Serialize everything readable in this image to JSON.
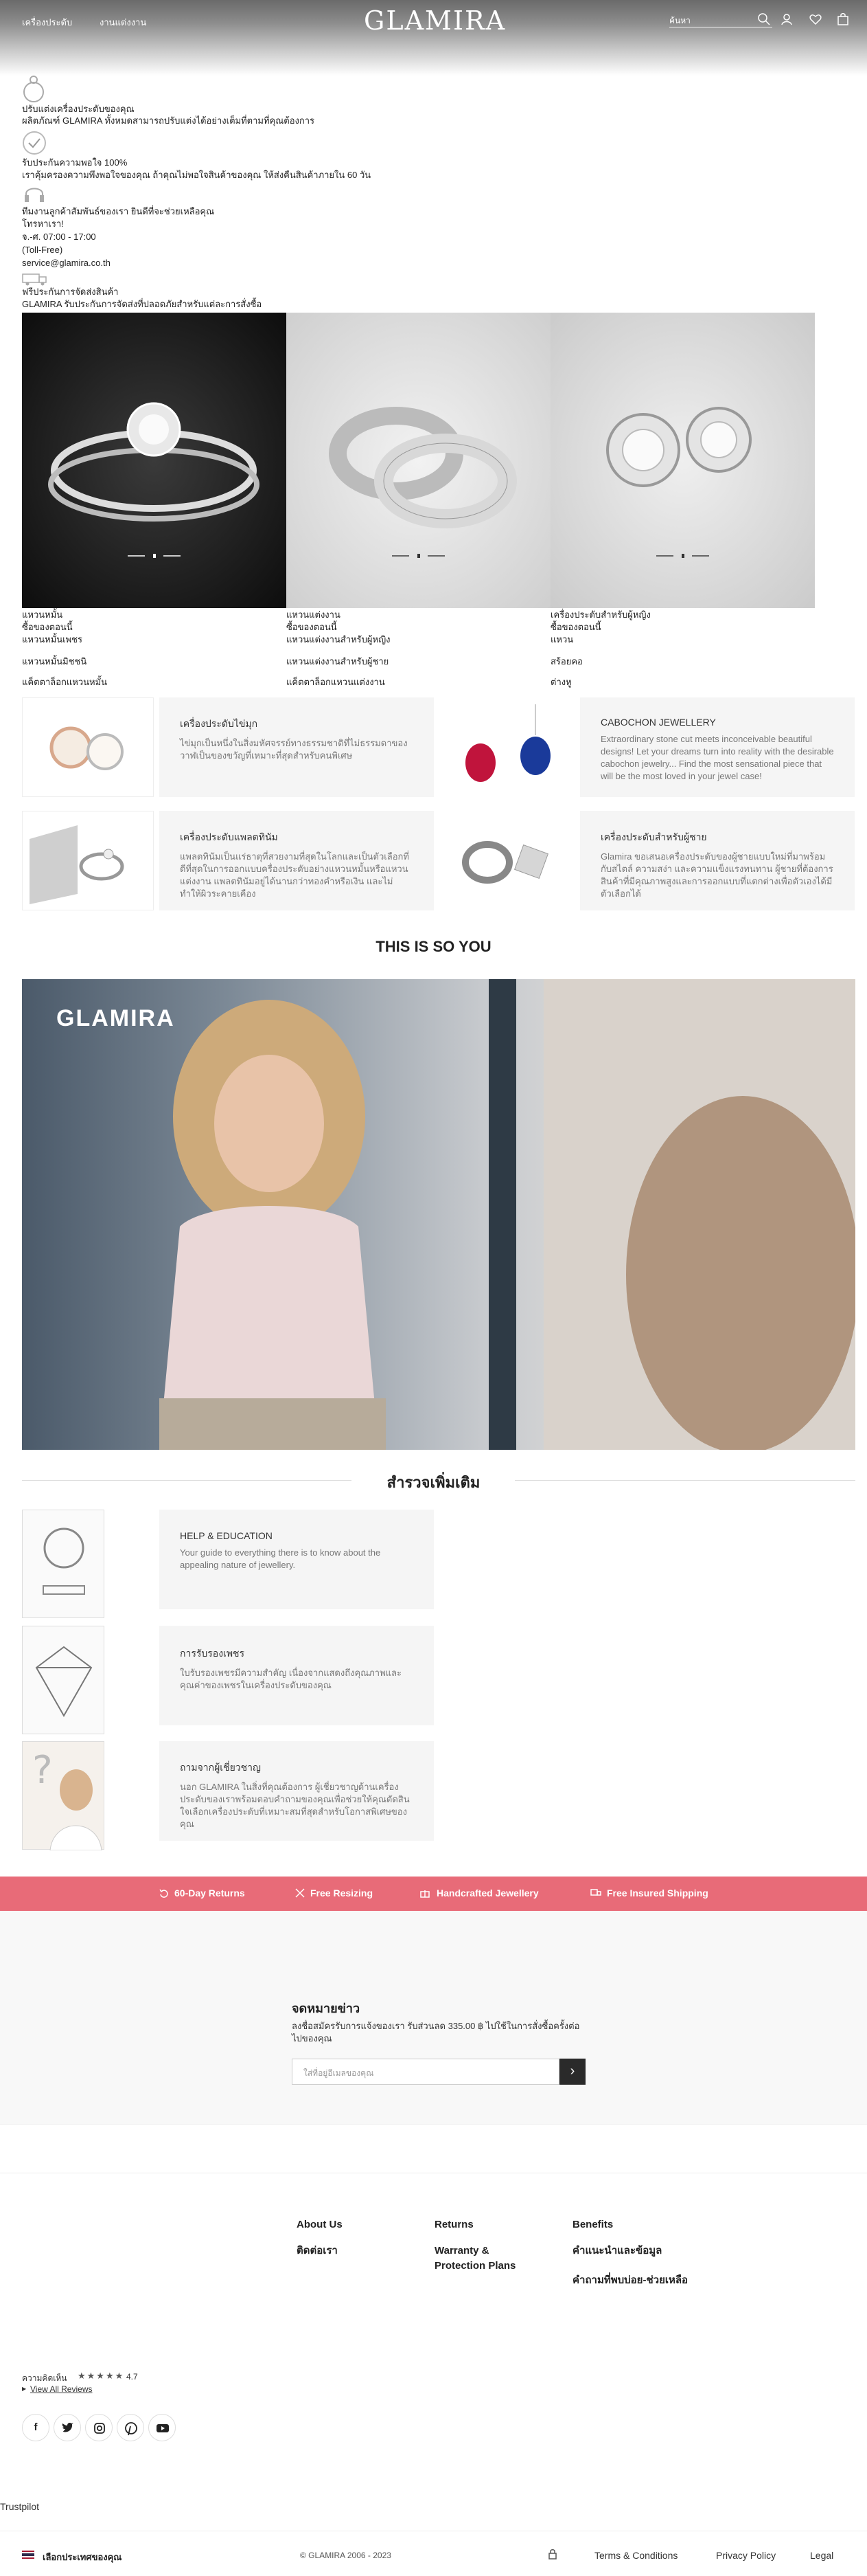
{
  "header": {
    "nav": [
      "เครื่องประดับ",
      "งานแต่งงาน"
    ],
    "logo": "GLAMIRA",
    "search_placeholder": "ค้นหา"
  },
  "benefits": [
    {
      "title": "ปรับแต่งเครื่องประดับของคุณ",
      "desc": "ผลิตภัณฑ์ GLAMIRA ทั้งหมดสามารถปรับแต่งได้อย่างเต็มที่ตามที่คุณต้องการ"
    },
    {
      "title": "รับประกันความพอใจ 100%",
      "desc": "เราคุ้มครองความพึงพอใจของคุณ ถ้าคุณไม่พอใจสินค้าของคุณ ให้ส่งคืนสินค้าภายใน 60 วัน"
    },
    {
      "title": "ทีมงานลูกค้าสัมพันธ์ของเรา ยินดีที่จะช่วยเหลือคุณ",
      "lines": [
        "โทรหาเรา!",
        "จ.-ศ. 07:00 - 17:00",
        "(Toll-Free)",
        "service@glamira.co.th"
      ]
    },
    {
      "title": "ฟรีประกันการจัดส่งสินค้า",
      "desc": "GLAMIRA รับประกันการจัดส่งที่ปลอดภัยสำหรับแต่ละการสั่งซื้อ"
    }
  ],
  "products": [
    {
      "name": "แหวนหมั้น",
      "link1": "ซื้อของตอนนี้",
      "sub1": "แหวนหมั้นเพชร",
      "sub2": "แหวนหมั้นมิชชนิ",
      "sub3": "แค็ตตาล็อกแหวนหมั้น"
    },
    {
      "name": "แหวนแต่งงาน",
      "link1": "ซื้อของตอนนี้",
      "sub1": "แหวนแต่งงานสำหรับผู้หญิง",
      "sub2": "แหวนแต่งงานสำหรับผู้ชาย",
      "sub3": "แค็ตตาล็อกแหวนแต่งงาน"
    },
    {
      "name": "เครื่องประดับสำหรับผู้หญิง",
      "link1": "ซื้อของตอนนี้",
      "sub1": "แหวน",
      "sub2": "สร้อยคอ",
      "sub3": "ต่างหู"
    }
  ],
  "categories": [
    {
      "title": "เครื่องประดับไข่มุก",
      "desc": "ไข่มุกเป็นหนึ่งในสิ่งมหัศจรรย์ทางธรรมชาติที่ไม่ธรรมดาของ วาฬเป็นของขวัญที่เหมาะที่สุดสำหรับคนพิเศษ"
    },
    {
      "title": "CABOCHON JEWELLERY",
      "desc": "Extraordinary stone cut meets inconceivable beautiful designs! Let your dreams turn into reality with the desirable cabochon jewelry... Find the most sensational piece that will be the most loved in your jewel case!"
    },
    {
      "title": "เครื่องประดับแพลตทินัม",
      "desc": "แพลตทินัมเป็นแร่ธาตุที่สวยงามที่สุดในโลกและเป็นตัวเลือกที่ดีที่สุดในการออกแบบครื่องประดับอย่างแหวนหมั้นหรือแหวนแต่งงาน แพลตทินัมอยู่ได้นานกว่าทองคำหรือเงิน และไม่ทำให้ผิวระคายเคือง"
    },
    {
      "title": "เครื่องประดับสำหรับผู้ชาย",
      "desc": "Glamira ขอเสนอเครื่องประดับของผู้ชายแบบใหม่ที่มาพร้อมกับสไตล์ ความสง่า และความแข็งแรงทนทาน ผู้ชายที่ต้องการสินค้าที่มีคุณภาพสูงและการออกแบบที่แตกต่างเพื่อตัวเองได้มีตัวเลือกได้"
    }
  ],
  "video_section": {
    "title": "THIS IS SO YOU",
    "watermark": "GLAMIRA"
  },
  "explore": {
    "title": "สำรวจเพิ่มเติม",
    "items": [
      {
        "title": "HELP & EDUCATION",
        "desc": "Your guide to everything there is to know about the appealing nature of jewellery."
      },
      {
        "title": "การรับรองเพชร",
        "desc": "ใบรับรองเพชรมีความสำคัญ เนื่องจากแสดงถึงคุณภาพและคุณค่าของเพชรในเครื่องประดับของคุณ"
      },
      {
        "title": "ถามจากผู้เชี่ยวชาญ",
        "desc": "นอก GLAMIRA ในสิ่งที่คุณต้องการ ผู้เชี่ยวชาญด้านเครื่องประดับของเราพร้อมตอบคำถามของคุณเพื่อช่วยให้คุณตัดสินใจเลือกเครื่องประดับที่เหมาะสมที่สุดสำหรับโอกาสพิเศษของคุณ"
      }
    ]
  },
  "pinkbar": [
    "60-Day Returns",
    "Free Resizing",
    "Handcrafted Jewellery",
    "Free Insured Shipping"
  ],
  "newsletter": {
    "title": "จดหมายข่าว",
    "desc": "ลงชื่อสมัครรับการแจ้งของเรา รับส่วนลด 335.00 ฿ ไปใช้ในการสั่งซื้อครั้งต่อไปของคุณ",
    "placeholder": "ใส่ที่อยู่อีเมลของคุณ",
    "submit": "›"
  },
  "footer": {
    "col1": [
      "About Us",
      "ติดต่อเรา"
    ],
    "col2": [
      "Returns",
      "Warranty & Protection Plans"
    ],
    "col3": [
      "Benefits",
      "คำแนะนำและข้อมูล",
      "คำถามที่พบบ่อย-ช่วยเหลือ"
    ],
    "rating_label": "ความคิดเห็น",
    "rating_value": "4.7",
    "reviews_link": "View All Reviews",
    "trustpilot": "Trustpilot",
    "country": "เลือกประเทศของคุณ",
    "copyright": "© GLAMIRA 2006 - 2023",
    "legal_links": [
      "Terms & Conditions",
      "Privacy Policy",
      "Legal"
    ]
  }
}
